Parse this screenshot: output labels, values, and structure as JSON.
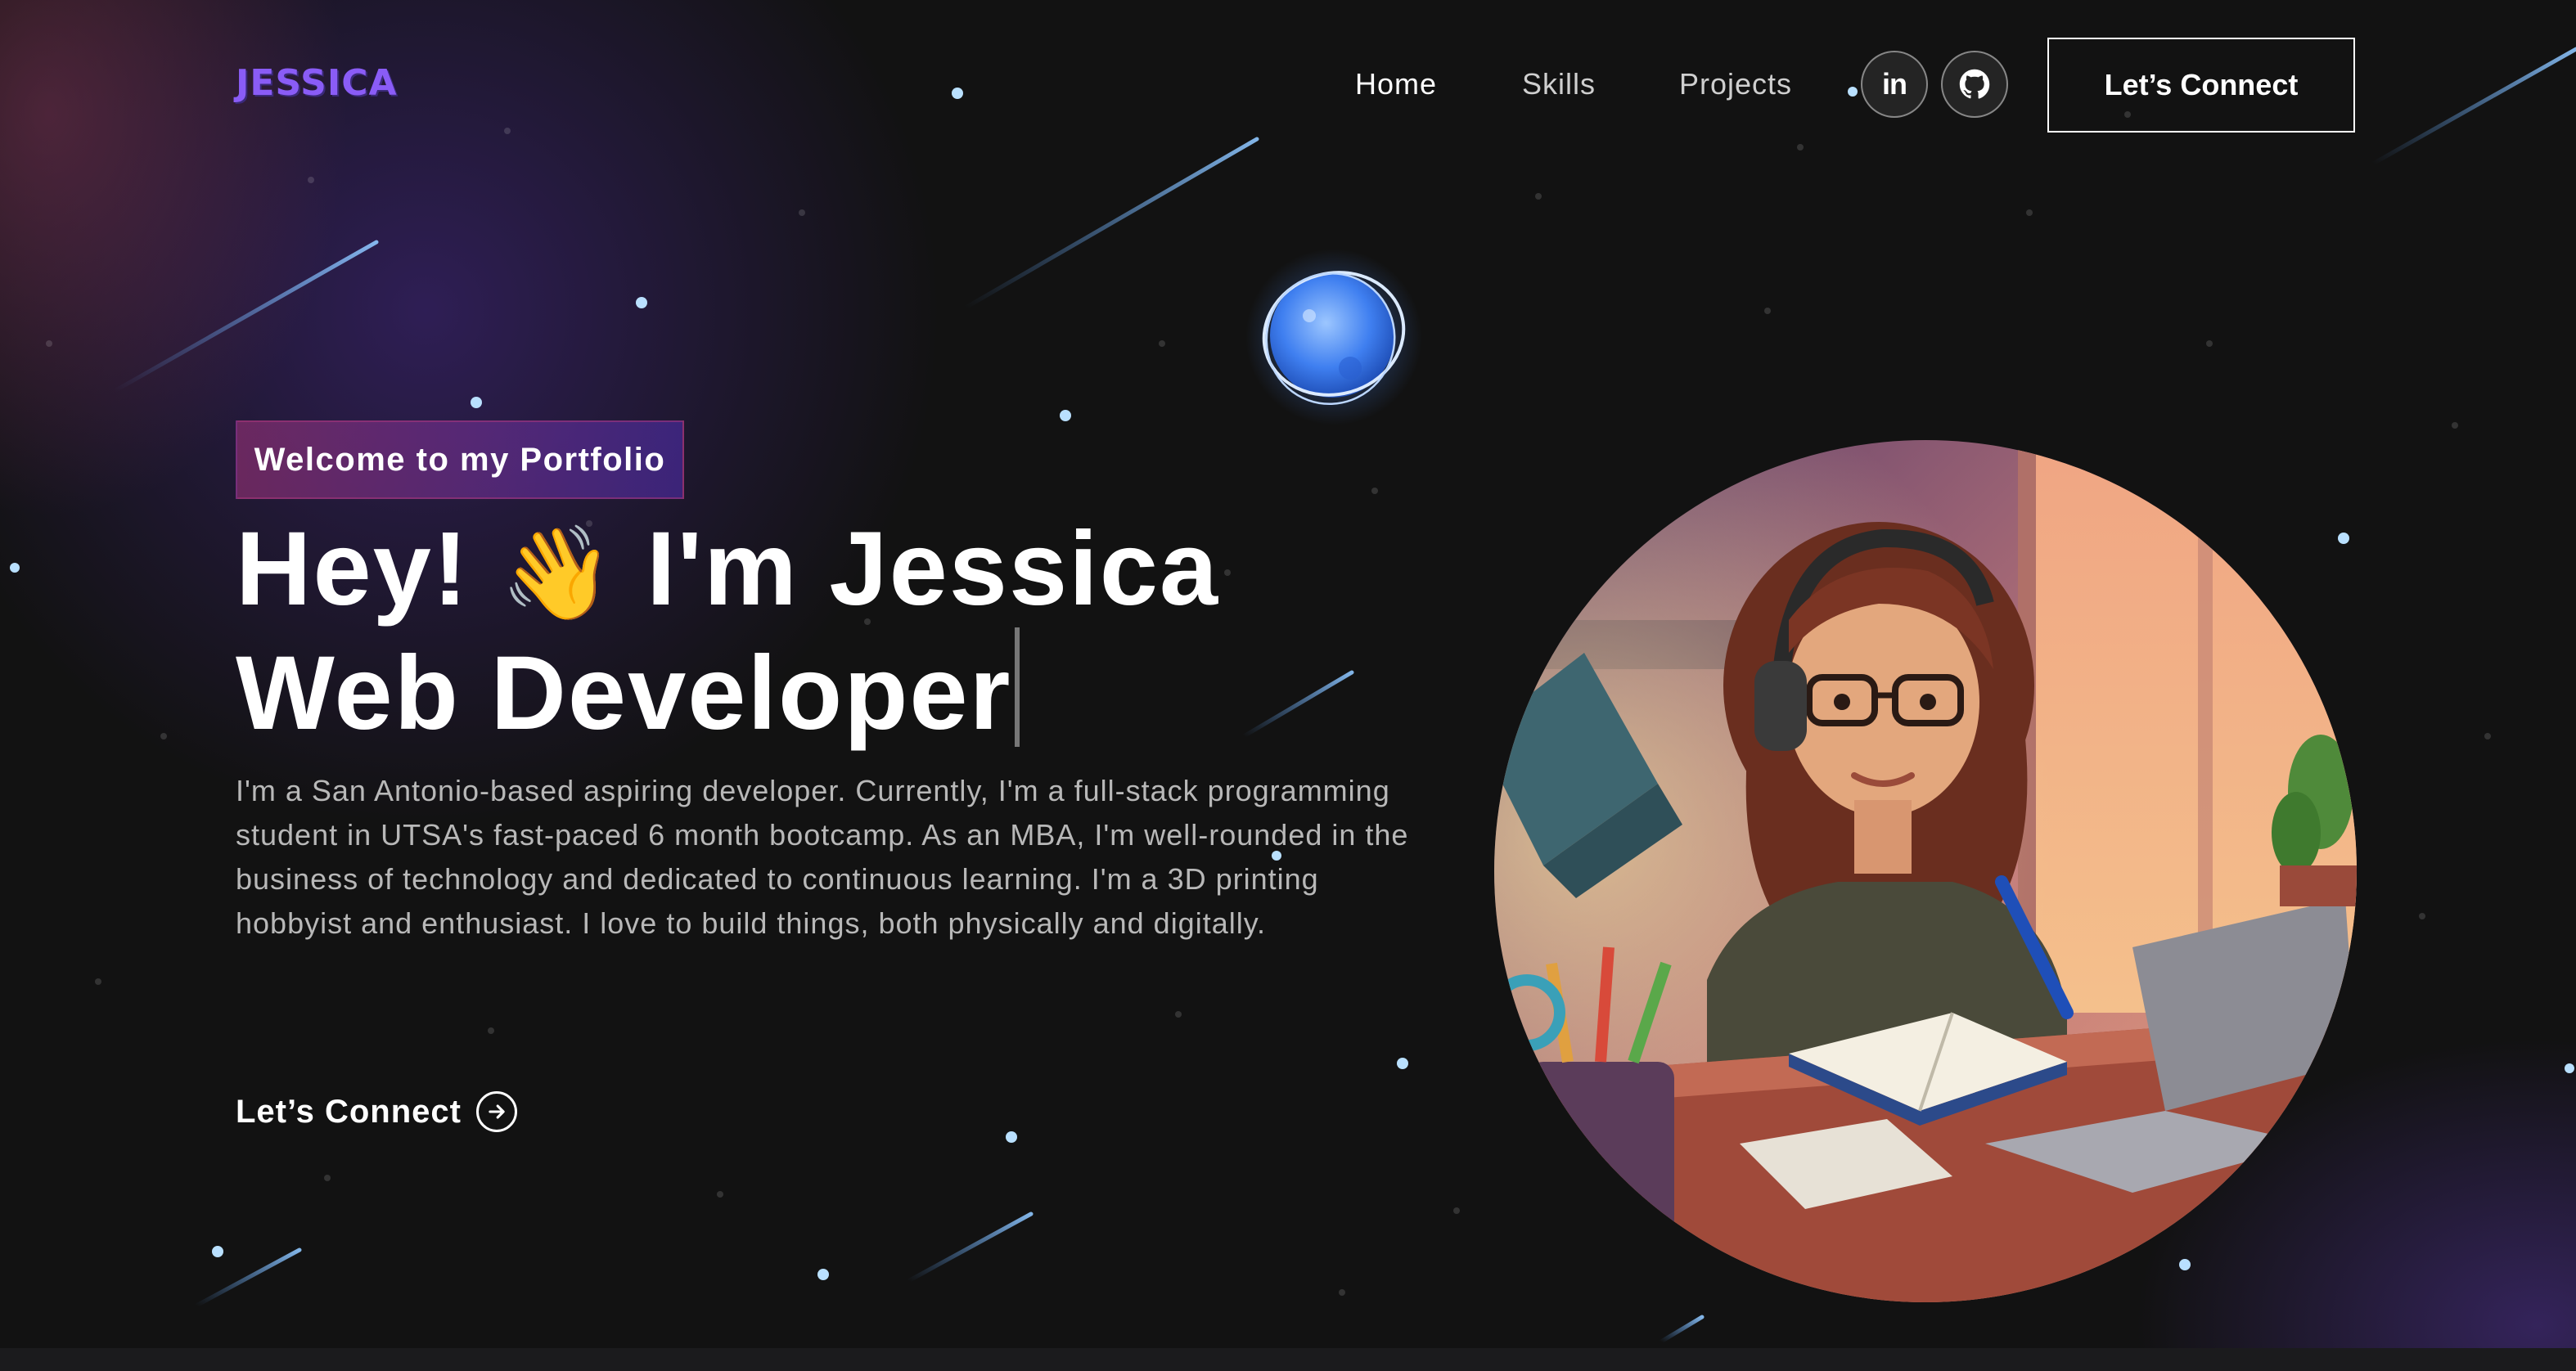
{
  "nav": {
    "logo": "JESSICA",
    "links": [
      "Home",
      "Skills",
      "Projects"
    ],
    "social": [
      {
        "name": "linkedin",
        "icon": "linkedin-icon",
        "label": "in"
      },
      {
        "name": "github",
        "icon": "github-icon"
      }
    ],
    "cta": "Let’s Connect"
  },
  "hero": {
    "tagline": "Welcome to my Portfolio",
    "greeting_prefix": "Hey!",
    "wave_emoji": "👋",
    "greeting_suffix": "I'm Jessica",
    "role": "Web Developer",
    "description": "I'm a San Antonio-based aspiring developer. Currently, I'm a full-stack programming student in UTSA's fast-paced 6 month bootcamp. As an MBA, I'm well-rounded in the business of technology and dedicated to continuous learning. I'm a 3D printing hobbyist and enthusiast. I love to build things, both physically and digitally.",
    "connect_link": "Let’s Connect",
    "connect_icon": "arrow-right-circle-icon"
  },
  "images": {
    "avatar": "avatar-illustration",
    "planet": "glowing-planet-icon"
  },
  "colors": {
    "background": "#121212",
    "logo": "#8a5cf6",
    "tagline_gradient_start": "#aa367c",
    "tagline_gradient_end": "#4a2fbd",
    "star": "#9fd3ff"
  }
}
